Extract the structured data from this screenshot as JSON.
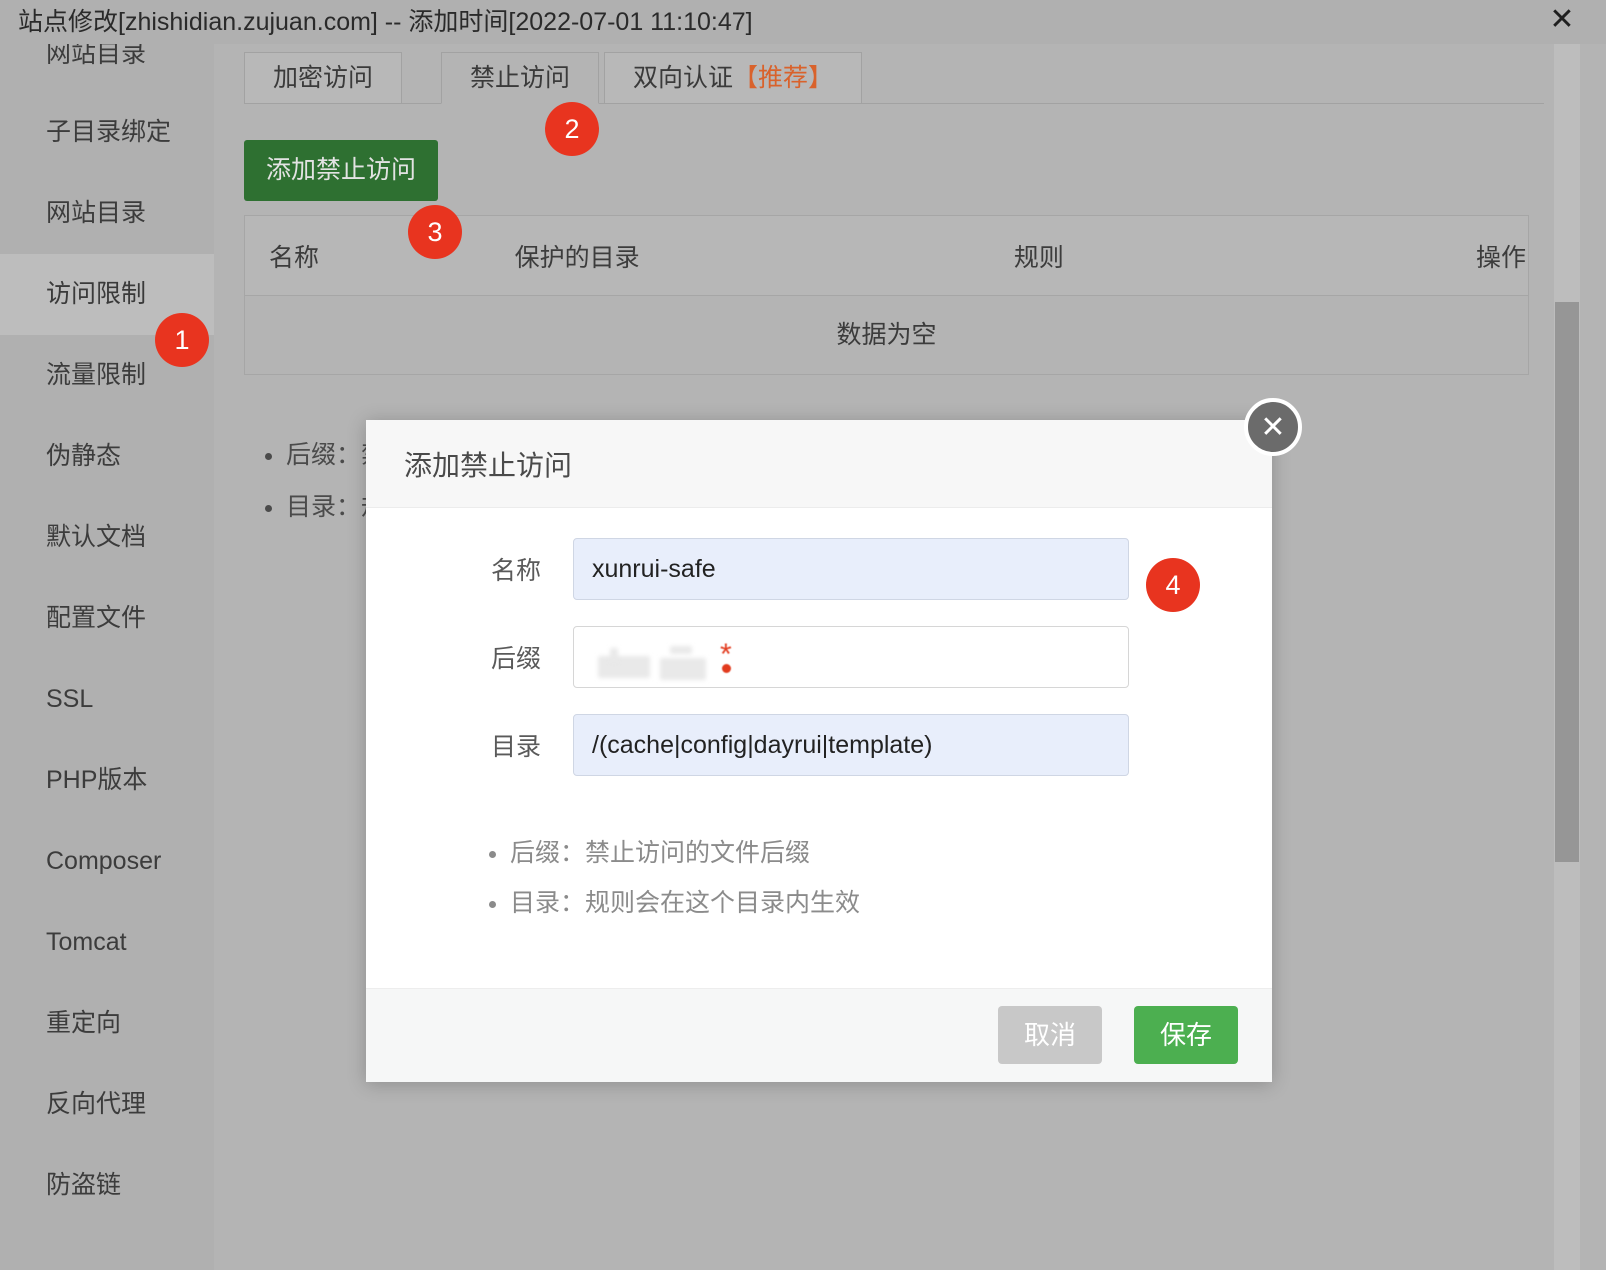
{
  "window": {
    "title": "站点修改[zhishidian.zujuan.com] -- 添加时间[2022-07-01 11:10:47]",
    "close_icon": "✕"
  },
  "sidebar": {
    "items": [
      {
        "label": "网站目录",
        "truncated": true,
        "active": false
      },
      {
        "label": "子目录绑定",
        "truncated": false,
        "active": false
      },
      {
        "label": "网站目录",
        "truncated": false,
        "active": false
      },
      {
        "label": "访问限制",
        "truncated": false,
        "active": true
      },
      {
        "label": "流量限制",
        "truncated": false,
        "active": false
      },
      {
        "label": "伪静态",
        "truncated": false,
        "active": false
      },
      {
        "label": "默认文档",
        "truncated": false,
        "active": false
      },
      {
        "label": "配置文件",
        "truncated": false,
        "active": false
      },
      {
        "label": "SSL",
        "truncated": false,
        "active": false
      },
      {
        "label": "PHP版本",
        "truncated": false,
        "active": false
      },
      {
        "label": "Composer",
        "truncated": false,
        "active": false
      },
      {
        "label": "Tomcat",
        "truncated": false,
        "active": false
      },
      {
        "label": "重定向",
        "truncated": false,
        "active": false
      },
      {
        "label": "反向代理",
        "truncated": false,
        "active": false
      },
      {
        "label": "防盗链",
        "truncated": false,
        "active": false
      }
    ]
  },
  "tabs": [
    {
      "label": "加密访问",
      "selected": false,
      "recommend": ""
    },
    {
      "label": "禁止访问",
      "selected": true,
      "recommend": ""
    },
    {
      "label": "双向认证",
      "selected": false,
      "recommend": "【推荐】"
    }
  ],
  "toolbar": {
    "add_label": "添加禁止访问"
  },
  "table": {
    "headers": [
      "名称",
      "保护的目录",
      "规则",
      "操作"
    ],
    "empty_text": "数据为空",
    "rows": []
  },
  "background_hints": [
    "后缀：禁止访问的文件后缀",
    "目录：规则会在这个目录内生效"
  ],
  "modal": {
    "title": "添加禁止访问",
    "close_icon": "✕",
    "fields": [
      {
        "label": "名称",
        "value": "xunrui-safe",
        "placeholder": "",
        "redacted": false
      },
      {
        "label": "后缀",
        "value": "",
        "placeholder": "",
        "redacted": true
      },
      {
        "label": "目录",
        "value": "/(cache|config|dayrui|template)",
        "placeholder": "",
        "redacted": false
      }
    ],
    "hints": [
      "后缀：禁止访问的文件后缀",
      "目录：规则会在这个目录内生效"
    ],
    "cancel_label": "取消",
    "save_label": "保存"
  },
  "annotations": [
    {
      "number": "1",
      "target": "访问限制"
    },
    {
      "number": "2",
      "target": "禁止访问"
    },
    {
      "number": "3",
      "target": "添加禁止访问"
    },
    {
      "number": "4",
      "target": "名称"
    }
  ],
  "colors": {
    "badge": "#e8341f",
    "primary_green": "#4caf50",
    "add_button_green": "#2e7031",
    "recommend_orange": "#d9622b",
    "field_focus_bg": "#e8eefb"
  }
}
